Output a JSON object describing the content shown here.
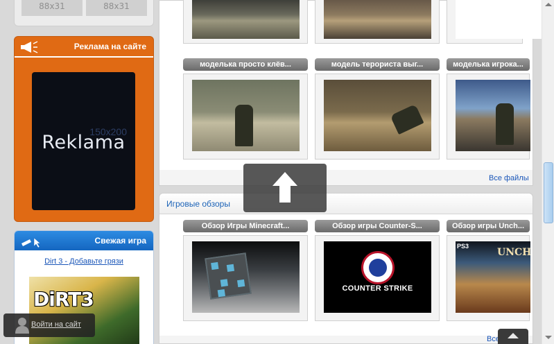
{
  "sidebar": {
    "banners": [
      "88x31",
      "88x31"
    ],
    "ad_section": {
      "title": "Реклама на сайте",
      "ad_size": "150x200",
      "ad_word": "Reklama"
    },
    "game_section": {
      "title": "Свежая игра",
      "game_link": "Dirt 3 - Добавьте грязи",
      "game_logo": "DiRT3"
    },
    "login": {
      "label": "Войти на сайт"
    }
  },
  "files_section": {
    "cards": [
      {
        "label": "моделька просто клёв..."
      },
      {
        "label": "модель терориста выг..."
      },
      {
        "label": "моделька игрока..."
      }
    ],
    "all_link": "Все файлы"
  },
  "reviews_section": {
    "title": "Игровые обзоры",
    "cards": [
      {
        "label": "Обзор Игры Minecraft..."
      },
      {
        "label": "Обзор игры Counter-S..."
      },
      {
        "label": "Обзор игры Unch..."
      }
    ],
    "cs_logo_text": "COUNTER STRIKE",
    "ps3_badge": "PS3",
    "uncharted_title": "UNCHARTED",
    "all_link": "Все обзоры"
  },
  "colors": {
    "accent_orange": "#e06a14",
    "accent_blue": "#1c63b7",
    "link": "#1a56b8"
  }
}
